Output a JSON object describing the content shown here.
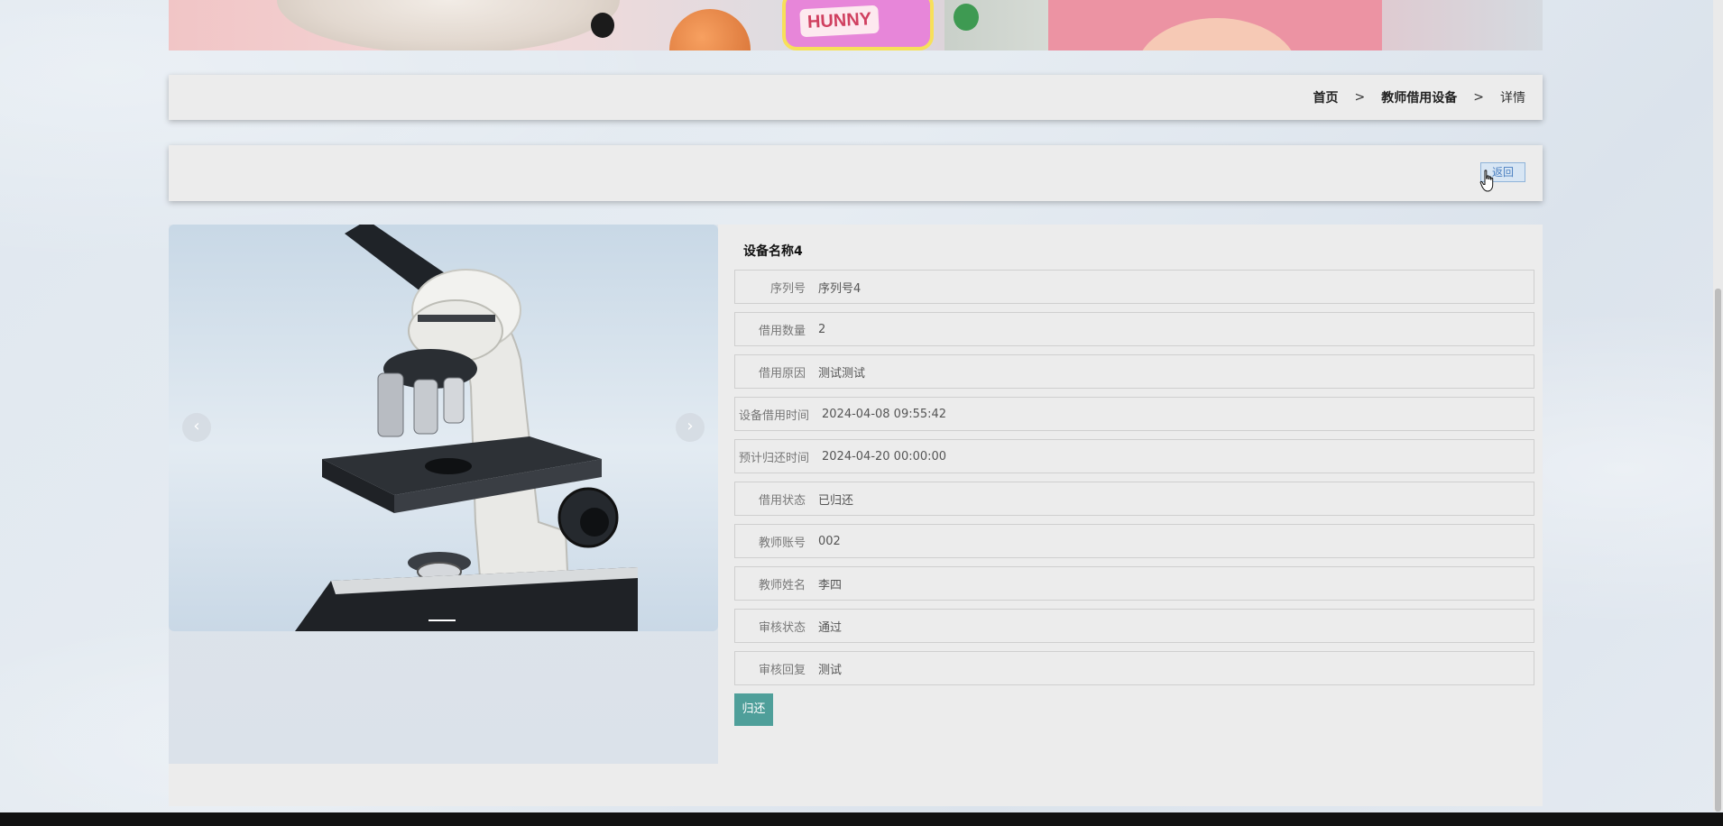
{
  "breadcrumb": {
    "items": [
      {
        "label": "首页"
      },
      {
        "label": "教师借用设备"
      },
      {
        "label": "详情"
      }
    ],
    "separator": ">"
  },
  "banner": {
    "toy_label": "HUNNY"
  },
  "actions": {
    "back_label": "返回",
    "return_label": "归还"
  },
  "carousel": {
    "prev_icon": "chevron-left",
    "next_icon": "chevron-right",
    "image": "microscope"
  },
  "detail": {
    "title": "设备名称4",
    "fields": [
      {
        "label": "序列号",
        "value": "序列号4"
      },
      {
        "label": "借用数量",
        "value": "2"
      },
      {
        "label": "借用原因",
        "value": "测试测试"
      },
      {
        "label": "设备借用时间",
        "value": "2024-04-08 09:55:42"
      },
      {
        "label": "预计归还时间",
        "value": "2024-04-20 00:00:00"
      },
      {
        "label": "借用状态",
        "value": "已归还"
      },
      {
        "label": "教师账号",
        "value": "002"
      },
      {
        "label": "教师姓名",
        "value": "李四"
      },
      {
        "label": "审核状态",
        "value": "通过"
      },
      {
        "label": "审核回复",
        "value": "测试"
      }
    ]
  },
  "colors": {
    "accent": "#4f9f9a",
    "back_button_border": "#8fb3d9",
    "panel_bg": "#ececec"
  }
}
